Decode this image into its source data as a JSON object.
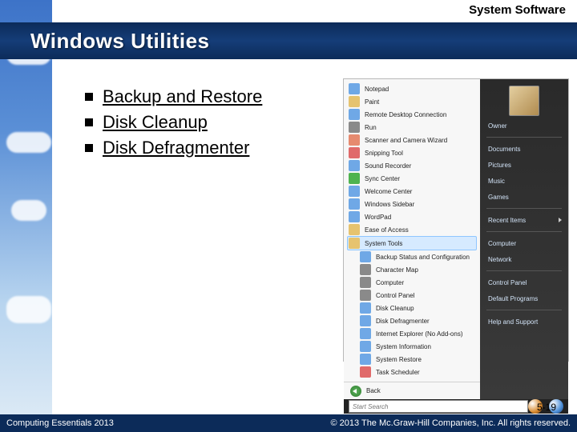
{
  "chapter": "System Software",
  "title": "Windows Utilities",
  "bullets": [
    "Backup and Restore",
    "Disk Cleanup",
    "Disk Defragmenter"
  ],
  "menu_left": [
    {
      "label": "Notepad",
      "color": "#6fa8e6"
    },
    {
      "label": "Paint",
      "color": "#e6c36f"
    },
    {
      "label": "Remote Desktop Connection",
      "color": "#6fa8e6"
    },
    {
      "label": "Run",
      "color": "#8a8a8a"
    },
    {
      "label": "Scanner and Camera Wizard",
      "color": "#e68a6f"
    },
    {
      "label": "Snipping Tool",
      "color": "#e06a6a"
    },
    {
      "label": "Sound Recorder",
      "color": "#6fa8e6"
    },
    {
      "label": "Sync Center",
      "color": "#4fb34f"
    },
    {
      "label": "Welcome Center",
      "color": "#6fa8e6"
    },
    {
      "label": "Windows Sidebar",
      "color": "#6fa8e6"
    },
    {
      "label": "WordPad",
      "color": "#6fa8e6"
    },
    {
      "label": "Ease of Access",
      "color": "#e6c36f"
    },
    {
      "label": "System Tools",
      "color": "#e6c36f",
      "highlight": true
    },
    {
      "label": "Backup Status and Configuration",
      "color": "#6fa8e6",
      "sub": true
    },
    {
      "label": "Character Map",
      "color": "#8a8a8a",
      "sub": true
    },
    {
      "label": "Computer",
      "color": "#8a8a8a",
      "sub": true
    },
    {
      "label": "Control Panel",
      "color": "#8a8a8a",
      "sub": true
    },
    {
      "label": "Disk Cleanup",
      "color": "#6fa8e6",
      "sub": true
    },
    {
      "label": "Disk Defragmenter",
      "color": "#6fa8e6",
      "sub": true
    },
    {
      "label": "Internet Explorer (No Add-ons)",
      "color": "#6fa8e6",
      "sub": true
    },
    {
      "label": "System Information",
      "color": "#6fa8e6",
      "sub": true
    },
    {
      "label": "System Restore",
      "color": "#6fa8e6",
      "sub": true
    },
    {
      "label": "Task Scheduler",
      "color": "#e06a6a",
      "sub": true
    }
  ],
  "menu_right": [
    "Owner",
    "Documents",
    "Pictures",
    "Music",
    "Games",
    "Recent Items",
    "Computer",
    "Network",
    "Control Panel",
    "Default Programs",
    "Help and Support"
  ],
  "back_label": "Back",
  "search_placeholder": "Start Search",
  "page_number": "5-19",
  "footer_left": "Computing Essentials 2013",
  "footer_right": "© 2013 The Mc.Graw-Hill Companies, Inc. All rights reserved."
}
